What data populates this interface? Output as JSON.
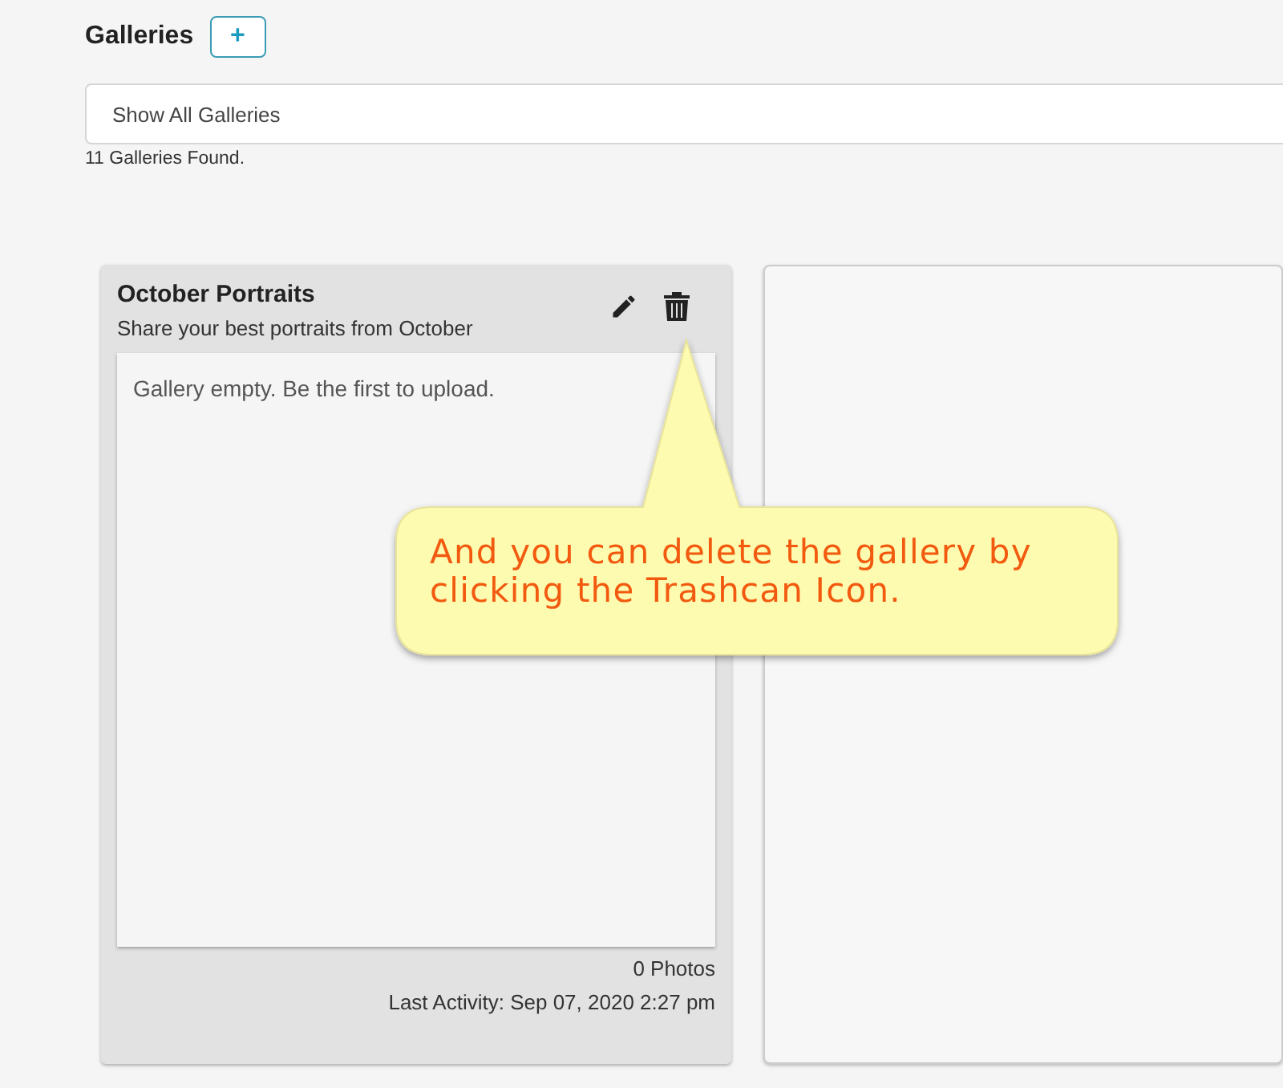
{
  "header": {
    "title": "Galleries",
    "add_button": "+"
  },
  "filter": {
    "value": "Show All Galleries"
  },
  "result_count": "11 Galleries Found.",
  "galleries": [
    {
      "kind": "gallery",
      "title": "October Portraits",
      "description": "Share your best portraits from October",
      "empty_message": "Gallery empty. Be the first to upload.",
      "photo_count": "0 Photos",
      "last_activity": "Last Activity: Sep 07, 2020 2:27 pm"
    },
    {
      "kind": "blank"
    }
  ],
  "callout": {
    "text": "And you can delete the gallery by clicking the Trashcan Icon."
  }
}
